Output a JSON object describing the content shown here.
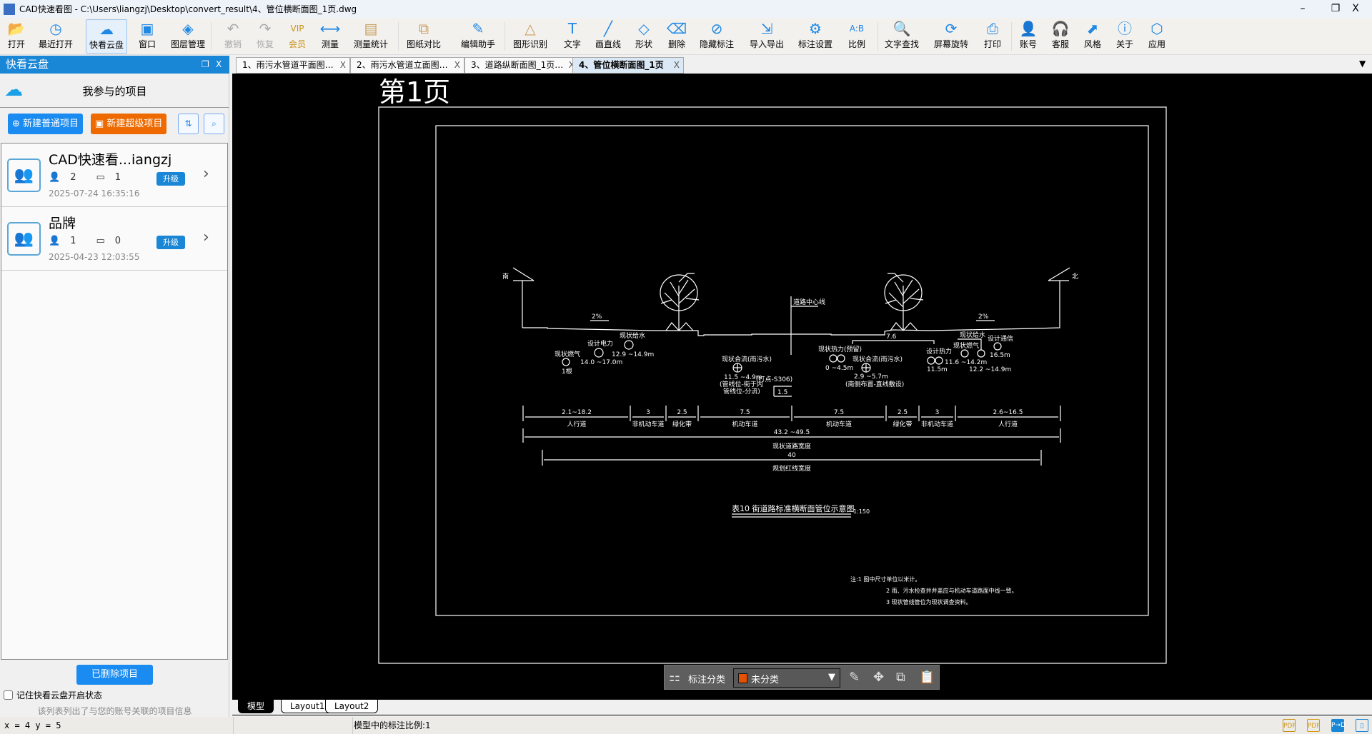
{
  "window": {
    "title": "CAD快速看图 - C:\\Users\\liangzj\\Desktop\\convert_result\\4、管位横断面图_1页.dwg",
    "logo": "CAD",
    "minimize": "–",
    "restore": "❐",
    "close": "X"
  },
  "toolbar": [
    {
      "id": "open",
      "label": "打开",
      "icon": "folder-icon",
      "glyph": "📂"
    },
    {
      "id": "recent",
      "label": "最近打开",
      "icon": "clock-icon",
      "glyph": "◷"
    },
    {
      "id": "cloud",
      "label": "快看云盘",
      "icon": "cloud-icon",
      "glyph": "☁",
      "selected": true
    },
    {
      "id": "window",
      "label": "窗口",
      "icon": "window-icon",
      "glyph": "▣"
    },
    {
      "id": "layers",
      "label": "图层管理",
      "icon": "layers-icon",
      "glyph": "◈"
    },
    {
      "id": "undo",
      "label": "撤销",
      "icon": "undo-icon",
      "glyph": "↶",
      "disabled": true
    },
    {
      "id": "redo",
      "label": "恢复",
      "icon": "redo-icon",
      "glyph": "↷",
      "disabled": true
    },
    {
      "id": "vip",
      "label": "会员",
      "icon": "vip-icon",
      "glyph": "VIP"
    },
    {
      "id": "measure",
      "label": "测量",
      "icon": "ruler-icon",
      "glyph": "⟷"
    },
    {
      "id": "measure-stats",
      "label": "测量统计",
      "icon": "chart-icon",
      "glyph": "▤"
    },
    {
      "id": "compare",
      "label": "图纸对比",
      "icon": "compare-icon",
      "glyph": "⧉"
    },
    {
      "id": "edit-helper",
      "label": "编辑助手",
      "icon": "cad-edit-icon",
      "glyph": "✎"
    },
    {
      "id": "shape-recog",
      "label": "图形识别",
      "icon": "shape-recognize-icon",
      "glyph": "△"
    },
    {
      "id": "text",
      "label": "文字",
      "icon": "text-icon",
      "glyph": "T"
    },
    {
      "id": "line",
      "label": "画直线",
      "icon": "line-icon",
      "glyph": "╱"
    },
    {
      "id": "shape",
      "label": "形状",
      "icon": "shape-icon",
      "glyph": "◇"
    },
    {
      "id": "erase",
      "label": "删除",
      "icon": "eraser-icon",
      "glyph": "⌫"
    },
    {
      "id": "hide-ann",
      "label": "隐藏标注",
      "icon": "eye-off-icon",
      "glyph": "⊘"
    },
    {
      "id": "import-export",
      "label": "导入导出",
      "icon": "import-export-icon",
      "glyph": "⇲"
    },
    {
      "id": "ann-settings",
      "label": "标注设置",
      "icon": "pen-gear-icon",
      "glyph": "⚙"
    },
    {
      "id": "scale",
      "label": "比例",
      "icon": "scale-icon",
      "glyph": "A:B"
    },
    {
      "id": "find-text",
      "label": "文字查找",
      "icon": "find-text-icon",
      "glyph": "🔍"
    },
    {
      "id": "rotate",
      "label": "屏幕旋转",
      "icon": "rotate-screen-icon",
      "glyph": "⟳"
    },
    {
      "id": "print",
      "label": "打印",
      "icon": "printer-icon",
      "glyph": "⎙"
    },
    {
      "id": "account",
      "label": "账号",
      "icon": "user-icon",
      "glyph": "👤"
    },
    {
      "id": "service",
      "label": "客服",
      "icon": "headset-icon",
      "glyph": "🎧"
    },
    {
      "id": "style",
      "label": "风格",
      "icon": "style-icon",
      "glyph": "⬈"
    },
    {
      "id": "about",
      "label": "关于",
      "icon": "info-icon",
      "glyph": "ⓘ"
    },
    {
      "id": "apps",
      "label": "应用",
      "icon": "cube-icon",
      "glyph": "⬡"
    }
  ],
  "sidebar": {
    "title": "快看云盘",
    "restore": "❐",
    "close": "X",
    "section_title": "我参与的项目",
    "new_normal": "新建普通项目",
    "new_super": "新建超级项目",
    "projects": [
      {
        "name": "CAD快速看...iangzj",
        "members": "2",
        "files": "1",
        "date": "2025-07-24 16:35:16",
        "badge": "升级"
      },
      {
        "name": "品牌",
        "members": "1",
        "files": "0",
        "date": "2025-04-23 12:03:55",
        "badge": "升级"
      }
    ],
    "deleted_button": "已删除项目",
    "remember_label": "记住快看云盘开启状态",
    "remember_checked": false,
    "info_text": "该列表列出了与您的账号关联的项目信息"
  },
  "tabs": [
    {
      "label": "1、雨污水管道平面图…",
      "close": "X"
    },
    {
      "label": "2、雨污水管道立面图…",
      "close": "X"
    },
    {
      "label": "3、道路纵断面图_1页…",
      "close": "X"
    },
    {
      "label": "4、管位横断面图_1页",
      "close": "X",
      "active": true
    }
  ],
  "tab_menu": "▼",
  "drawing": {
    "page_label": "第1页",
    "south": "南",
    "north": "北",
    "centerline": "道路中心线",
    "slope_left": "2%",
    "slope_right": "2%",
    "utilities": [
      {
        "name": "现状燃气",
        "sub": "1根"
      },
      {
        "name": "设计电力",
        "depth": "14.0 ~17.0m"
      },
      {
        "name": "现状给水",
        "depth": "12.9 ~14.9m"
      },
      {
        "name": "现状合流(雨污水)",
        "depth": "11.5 ~4.9m",
        "note1": "(管线位-街于内",
        "note2": "管线位-分流)",
        "extra": "(打点-S306)"
      },
      {
        "name": "现状热力(预留)",
        "depth": "0 ~4.5m"
      },
      {
        "name": "现状合流(雨污水)",
        "depth": "2.9 ~5.7m",
        "note1": "(南侧布置-直线敷设)"
      },
      {
        "name": "设计热力",
        "depth": "11.6 ~14.2m",
        "sub": "11.5m"
      },
      {
        "name": "现状给水"
      },
      {
        "name": "现状燃气",
        "depth": "12.2 ~14.9m"
      },
      {
        "name": "设计通信",
        "depth": "16.5m"
      }
    ],
    "dim_small": "1.5",
    "bracket_label": "7.6",
    "segments": [
      {
        "width": "2.1~18.2",
        "name": "人行道"
      },
      {
        "width": "3",
        "name": "非机动车道"
      },
      {
        "width": "2.5",
        "name": "绿化带"
      },
      {
        "width": "7.5",
        "name": "机动车道"
      },
      {
        "width": "7.5",
        "name": "机动车道"
      },
      {
        "width": "2.5",
        "name": "绿化带"
      },
      {
        "width": "3",
        "name": "非机动车道"
      },
      {
        "width": "2.6~16.5",
        "name": "人行道"
      }
    ],
    "total_width": "43.2 ~49.5",
    "total_label": "现状道路宽度",
    "red_width": "40",
    "red_label": "规划红线宽度",
    "title": "表10 街道路标准横断面管位示意图",
    "scale": "1:150",
    "notes": [
      "注:1 图中尺寸单位以米计。",
      "2 雨、污水检查井井盖应与机动车道路面中线一致。",
      "3 现状管线管位为现状调查资料。"
    ]
  },
  "annotation_bar": {
    "label": "标注分类",
    "category": "未分类",
    "category_color": "#e65100",
    "arrow": "▼"
  },
  "layouts": [
    "模型",
    "Layout1",
    "Layout2"
  ],
  "status": {
    "coords": "x = 4 y = 5",
    "scale_text": "模型中的标注比例:1"
  },
  "colors": {
    "accent": "#1a86d6",
    "orange": "#ee6a00",
    "canvas": "#000000"
  }
}
